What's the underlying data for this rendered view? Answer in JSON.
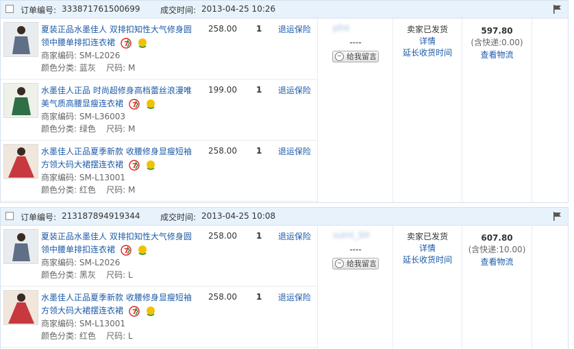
{
  "labels": {
    "order_no": "订单编号:",
    "deal_time": "成交时间:",
    "sku": "商家编码:",
    "color": "颜色分类:",
    "size": "尺码:",
    "insurance": "退运保险",
    "leave_msg": "给我留言",
    "dash": "----",
    "status": "卖家已发货",
    "detail": "详情",
    "extend": "延长收货时间",
    "logistics": "查看物流"
  },
  "orders": [
    {
      "order_no": "333871761500699",
      "deal_time": "2013-04-25 10:26",
      "buyer": "pfnt",
      "total": "597.80",
      "shipping": "(含快递:0.00)",
      "items": [
        {
          "title": "夏装正品水墨佳人 双排扣知性大气修身圆领中腰单排扣连衣裙",
          "sku": "SM-L2026",
          "color": "蓝灰",
          "size": "M",
          "price": "258.00",
          "qty": "1",
          "thumb_color": "#5e6f86"
        },
        {
          "title": "水墨佳人正品 时尚超修身高档蕾丝浪漫唯美气质高腰显瘦连衣裙",
          "sku": "SM-L36003",
          "color": "绿色",
          "size": "M",
          "price": "199.00",
          "qty": "1",
          "thumb_color": "#2f6f45"
        },
        {
          "title": "水墨佳人正品夏季新款 收腰修身显瘦短袖方领大码大裙摆连衣裙",
          "sku": "SM-L13001",
          "color": "红色",
          "size": "M",
          "price": "258.00",
          "qty": "1",
          "thumb_color": "#c7393f"
        }
      ]
    },
    {
      "order_no": "213187894919344",
      "deal_time": "2013-04-25 10:08",
      "buyer": "sutnt_SH",
      "total": "607.80",
      "shipping": "(含快递:10.00)",
      "items": [
        {
          "title": "夏装正品水墨佳人 双排扣知性大气修身圆领中腰单排扣连衣裙",
          "sku": "SM-L2026",
          "color": "黑灰",
          "size": "L",
          "price": "258.00",
          "qty": "1",
          "thumb_color": "#5e6f86"
        },
        {
          "title": "水墨佳人正品夏季新款 收腰修身显瘦短袖方领大码大裙摆连衣裙",
          "sku": "SM-L13001",
          "color": "红色",
          "size": "L",
          "price": "258.00",
          "qty": "1",
          "thumb_color": "#c7393f"
        }
      ]
    }
  ]
}
